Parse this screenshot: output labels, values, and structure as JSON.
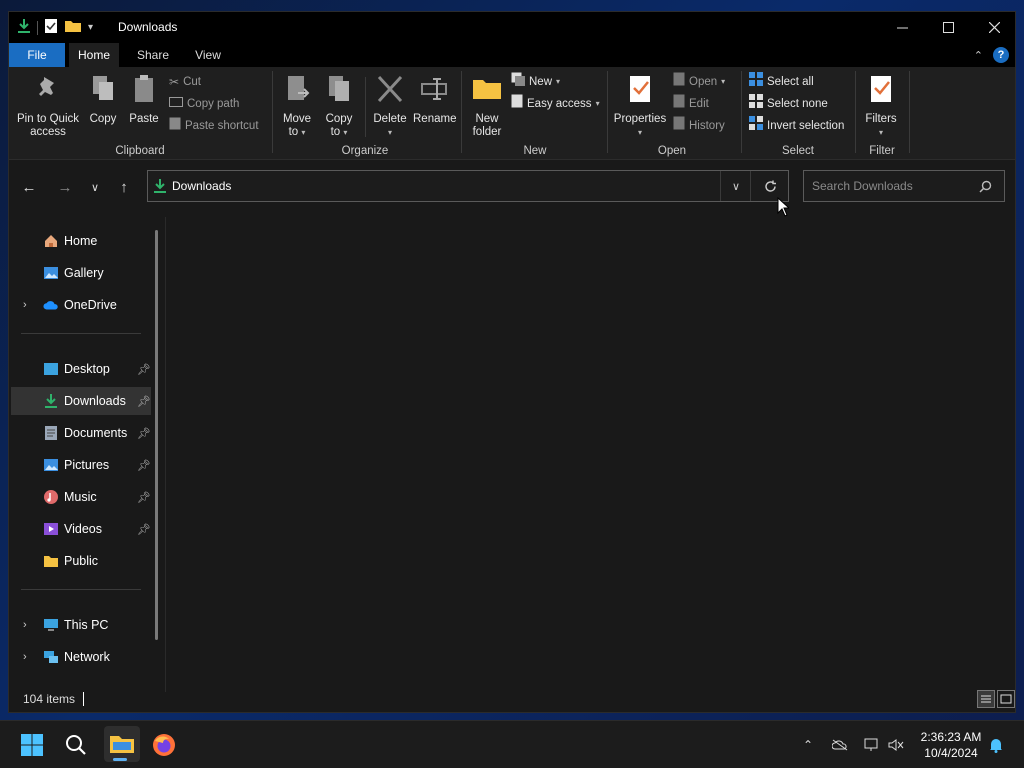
{
  "window": {
    "title": "Downloads"
  },
  "ribbon_tabs": {
    "file": "File",
    "home": "Home",
    "share": "Share",
    "view": "View"
  },
  "clipboard": {
    "pin_label_1": "Pin to Quick",
    "pin_label_2": "access",
    "copy": "Copy",
    "paste": "Paste",
    "cut": "Cut",
    "copy_path": "Copy path",
    "paste_shortcut": "Paste shortcut",
    "group_label": "Clipboard"
  },
  "organize": {
    "move_1": "Move",
    "move_2": "to",
    "copy_1": "Copy",
    "copy_2": "to",
    "delete": "Delete",
    "rename": "Rename",
    "group_label": "Organize"
  },
  "new_group": {
    "new_folder_1": "New",
    "new_folder_2": "folder",
    "new_item": "New",
    "easy_access": "Easy access",
    "group_label": "New"
  },
  "open_group": {
    "properties": "Properties",
    "open": "Open",
    "edit": "Edit",
    "history": "History",
    "group_label": "Open"
  },
  "select_group": {
    "select_all": "Select all",
    "select_none": "Select none",
    "invert": "Invert selection",
    "group_label": "Select"
  },
  "filter_group": {
    "filters": "Filters",
    "group_label": "Filter"
  },
  "address": {
    "path": "Downloads",
    "search_placeholder": "Search Downloads"
  },
  "sidebar": {
    "items": [
      {
        "label": "Home"
      },
      {
        "label": "Gallery"
      },
      {
        "label": "OneDrive"
      },
      {
        "label": "Desktop"
      },
      {
        "label": "Downloads"
      },
      {
        "label": "Documents"
      },
      {
        "label": "Pictures"
      },
      {
        "label": "Music"
      },
      {
        "label": "Videos"
      },
      {
        "label": "Public"
      },
      {
        "label": "This PC"
      },
      {
        "label": "Network"
      }
    ]
  },
  "status": {
    "item_count": "104 items"
  },
  "taskbar": {
    "time": "2:36:23 AM",
    "date": "10/4/2024"
  },
  "colors": {
    "accent": "#1a6dc2",
    "folder": "#f5c242",
    "downloads_green": "#2fb36b"
  }
}
